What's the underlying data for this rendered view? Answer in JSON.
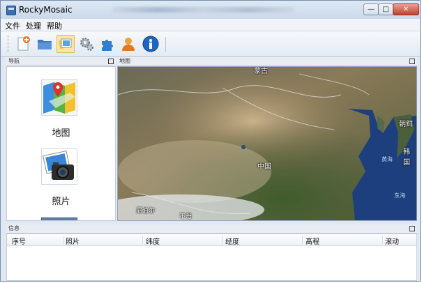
{
  "window": {
    "title": "RockyMosaic",
    "minimize": "—",
    "maximize": "□",
    "close": "✕"
  },
  "menu": [
    "文件",
    "处理",
    "帮助"
  ],
  "toolbar": [
    {
      "name": "new-project-icon"
    },
    {
      "name": "open-folder-icon"
    },
    {
      "name": "image-stack-icon",
      "active": true
    },
    {
      "name": "settings-gears-icon"
    },
    {
      "name": "plugin-puzzle-icon"
    },
    {
      "name": "user-icon"
    },
    {
      "name": "info-icon"
    }
  ],
  "panels": {
    "nav": {
      "title": "导航",
      "items": [
        {
          "label": "地图",
          "icon": "map-icon"
        },
        {
          "label": "照片",
          "icon": "camera-photo-icon"
        }
      ]
    },
    "map": {
      "title": "地图",
      "labels": [
        "蒙古",
        "中国",
        "朝鲜",
        "韩国",
        "黄海",
        "东海",
        "尼泊尔",
        "不丹"
      ]
    },
    "info": {
      "title": "信息",
      "columns": [
        "序号",
        "照片",
        "纬度",
        "经度",
        "高程",
        "滚动"
      ]
    }
  },
  "colors": {
    "accent": "#3a6fb0",
    "active_tool_bg": "#f7e6a6",
    "close_button": "#c0402e"
  }
}
